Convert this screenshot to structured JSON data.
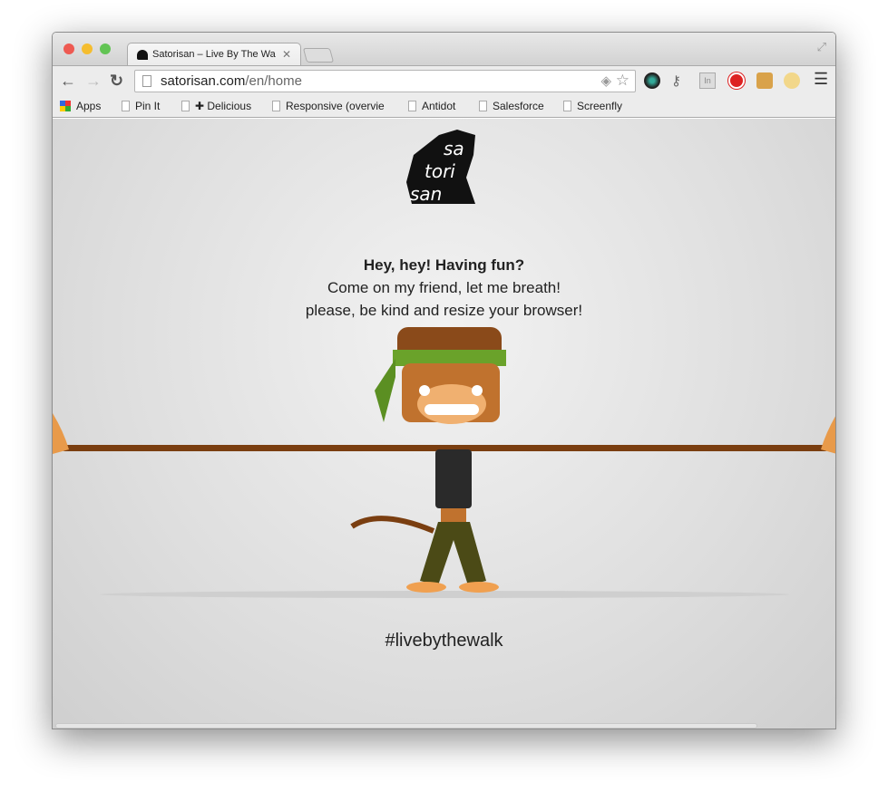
{
  "browser": {
    "tab_title": "Satorisan – Live By The Wa",
    "url_host": "satorisan.com",
    "url_path": "/en/home",
    "bookmarks": [
      "Apps",
      "Pin It",
      "✚ Delicious",
      "Responsive (overvie",
      "Antidot",
      "Salesforce",
      "Screenfly"
    ]
  },
  "page": {
    "logo_text": "sa tori san",
    "heading": "Hey, hey! Having fun?",
    "line1": "Come on my friend, let me breath!",
    "line2": "please, be kind and resize your browser!",
    "hashtag": "#livebythewalk"
  },
  "colors": {
    "close": "#ee5a52",
    "minimize": "#f5bd2f",
    "maximize": "#62c454"
  }
}
